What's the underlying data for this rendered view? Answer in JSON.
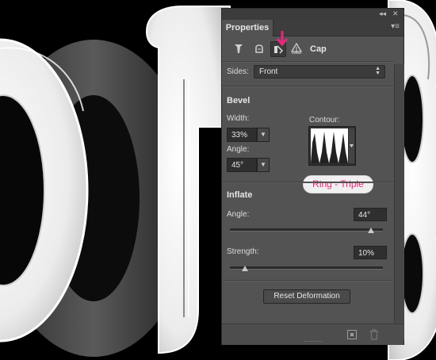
{
  "panel": {
    "tab_label": "Properties",
    "collapse_glyph": "◂◂",
    "close_glyph": "✕",
    "menu_glyph": "▾≡",
    "toolbar": {
      "icons": [
        "mesh-icon",
        "deform-icon",
        "cap-icon",
        "coordinates-icon"
      ],
      "selected": "cap-icon",
      "section_label": "Cap"
    },
    "sides": {
      "label": "Sides:",
      "value": "Front"
    },
    "bevel": {
      "header": "Bevel",
      "width_label": "Width:",
      "width_value": "33%",
      "angle_label": "Angle:",
      "angle_value": "45°",
      "contour_label": "Contour:",
      "contour_tooltip": "Ring - Triple"
    },
    "inflate": {
      "header": "Inflate",
      "angle_label": "Angle:",
      "angle_value": "44°",
      "angle_fraction": 0.92,
      "strength_label": "Strength:",
      "strength_value": "10%",
      "strength_fraction": 0.1
    },
    "reset_button": "Reset Deformation",
    "bottom_icons": [
      "new-layer-icon",
      "trash-icon"
    ]
  },
  "colors": {
    "accent_pink": "#e8277e",
    "panel_bg": "#535353"
  }
}
